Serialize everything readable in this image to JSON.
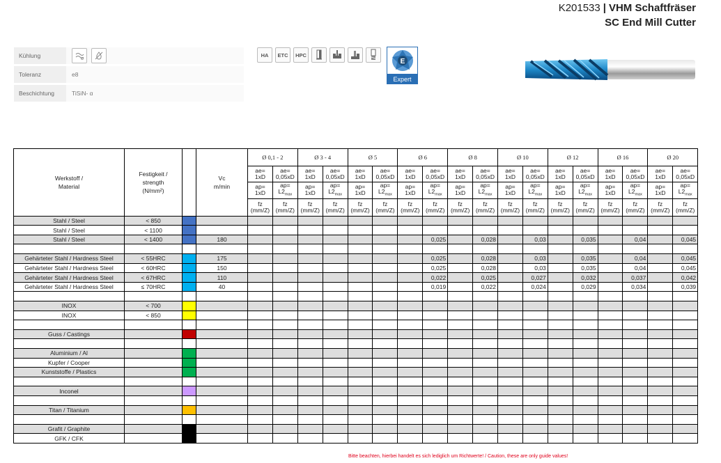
{
  "header": {
    "code": "K201533",
    "separator": "|",
    "name_de": "VHM Schaftfräser",
    "name_en": "SC End Mill Cutter"
  },
  "properties": [
    {
      "label": "Kühlung",
      "value": ""
    },
    {
      "label": "Toleranz",
      "value": "e8"
    },
    {
      "label": "Beschichtung",
      "value": "TiSiN- α"
    }
  ],
  "badges": [
    "HA",
    "ETC",
    "HPC"
  ],
  "expert_label": "Expert",
  "table": {
    "col_material": "Werkstoff /\nMaterial",
    "col_strength_1": "Festigkeit /",
    "col_strength_2": "strength",
    "col_strength_3": "(N/mm²)",
    "col_vc_1": "Vc",
    "col_vc_2": "m/min",
    "diameters": [
      "Ø 0,1 - 2",
      "Ø 3 - 4",
      "Ø 5",
      "Ø 6",
      "Ø 8",
      "Ø 10",
      "Ø 12",
      "Ø 16",
      "Ø 20"
    ],
    "sub_ae": [
      "ae=\n1xD",
      "ae=\n0,05xD"
    ],
    "sub_ap": [
      "ap=\n1xD",
      "ap=\nL2max"
    ],
    "sub_fz": "fz\n(mm/Z)",
    "rows": [
      {
        "material": "Stahl / Steel",
        "strength": "< 850",
        "color": "#4472c4",
        "vc": "",
        "fz": [],
        "grey": true
      },
      {
        "material": "Stahl / Steel",
        "strength": "< 1100",
        "color": "#4472c4",
        "vc": "",
        "fz": [],
        "grey": false
      },
      {
        "material": "Stahl / Steel",
        "strength": "< 1400",
        "color": "#4472c4",
        "vc": "180",
        "fz": [
          "",
          "",
          "",
          "0,025",
          "0,028",
          "0,03",
          "0,035",
          "0,04",
          "0,045"
        ],
        "grey": true
      },
      {
        "material": "",
        "strength": "",
        "color": "",
        "vc": "",
        "fz": [],
        "grey": false
      },
      {
        "material": "Gehärteter Stahl / Hardness Steel",
        "strength": "< 55HRC",
        "color": "#00b0f0",
        "vc": "175",
        "fz": [
          "",
          "",
          "",
          "0,025",
          "0,028",
          "0,03",
          "0,035",
          "0,04",
          "0,045"
        ],
        "grey": true
      },
      {
        "material": "Gehärteter Stahl / Hardness Steel",
        "strength": "< 60HRC",
        "color": "#00b0f0",
        "vc": "150",
        "fz": [
          "",
          "",
          "",
          "0,025",
          "0,028",
          "0,03",
          "0,035",
          "0,04",
          "0,045"
        ],
        "grey": false
      },
      {
        "material": "Gehärteter Stahl / Hardness Steel",
        "strength": "< 67HRC",
        "color": "#00b0f0",
        "vc": "110",
        "fz": [
          "",
          "",
          "",
          "0,022",
          "0,025",
          "0,027",
          "0,032",
          "0,037",
          "0,042"
        ],
        "grey": true
      },
      {
        "material": "Gehärteter Stahl / Hardness Steel",
        "strength": "≤ 70HRC",
        "color": "#00b0f0",
        "vc": "40",
        "fz": [
          "",
          "",
          "",
          "0,019",
          "0,022",
          "0,024",
          "0,029",
          "0,034",
          "0,039"
        ],
        "grey": false
      },
      {
        "material": "",
        "strength": "",
        "color": "",
        "vc": "",
        "fz": [],
        "grey": false
      },
      {
        "material": "INOX",
        "strength": "< 700",
        "color": "#ffff00",
        "vc": "",
        "fz": [],
        "grey": true
      },
      {
        "material": "INOX",
        "strength": "< 850",
        "color": "#ffff00",
        "vc": "",
        "fz": [],
        "grey": false
      },
      {
        "material": "",
        "strength": "",
        "color": "",
        "vc": "",
        "fz": [],
        "grey": false
      },
      {
        "material": "Guss / Castings",
        "strength": "",
        "color": "#c00000",
        "vc": "",
        "fz": [],
        "grey": true
      },
      {
        "material": "",
        "strength": "",
        "color": "",
        "vc": "",
        "fz": [],
        "grey": false
      },
      {
        "material": "Aluminium / Al",
        "strength": "",
        "color": "#00b050",
        "vc": "",
        "fz": [],
        "grey": true
      },
      {
        "material": "Kupfer / Cooper",
        "strength": "",
        "color": "#00b050",
        "vc": "",
        "fz": [],
        "grey": false
      },
      {
        "material": "Kunststoffe / Plastics",
        "strength": "",
        "color": "#00b050",
        "vc": "",
        "fz": [],
        "grey": true
      },
      {
        "material": "",
        "strength": "",
        "color": "",
        "vc": "",
        "fz": [],
        "grey": false
      },
      {
        "material": "Inconel",
        "strength": "",
        "color": "#cc99ff",
        "vc": "",
        "fz": [],
        "grey": true
      },
      {
        "material": "",
        "strength": "",
        "color": "",
        "vc": "",
        "fz": [],
        "grey": false
      },
      {
        "material": "Titan / Titanium",
        "strength": "",
        "color": "#ffc000",
        "vc": "",
        "fz": [],
        "grey": true
      },
      {
        "material": "",
        "strength": "",
        "color": "",
        "vc": "",
        "fz": [],
        "grey": false
      },
      {
        "material": "Grafit / Graphite",
        "strength": "",
        "color": "#000000",
        "vc": "",
        "fz": [],
        "grey": true
      },
      {
        "material": "GFK / CFK",
        "strength": "",
        "color": "#000000",
        "vc": "",
        "fz": [],
        "grey": false
      }
    ]
  },
  "footer": "Bitte beachten, hierbei handelt es sich lediglich um Richtwerte!  /  Caution, these are only guide values!"
}
